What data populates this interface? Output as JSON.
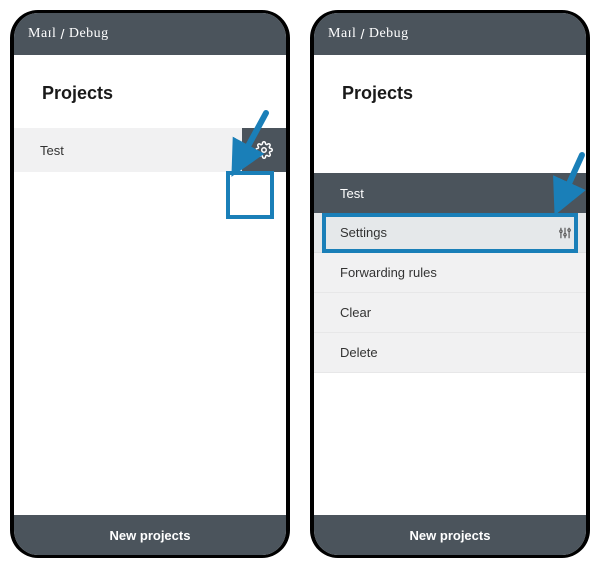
{
  "app_name_left": "Maɪl",
  "app_name_right": "Debug",
  "page_title": "Projects",
  "project_row_label": "Test",
  "footer_label": "New projects",
  "menu": {
    "header_label": "Test",
    "items": [
      {
        "label": "Settings",
        "icon": "sliders"
      },
      {
        "label": "Forwarding rules",
        "icon": ""
      },
      {
        "label": "Clear",
        "icon": ""
      },
      {
        "label": "Delete",
        "icon": ""
      }
    ]
  },
  "highlight_color": "#1a7fb8",
  "arrow_color": "#1a7fb8"
}
